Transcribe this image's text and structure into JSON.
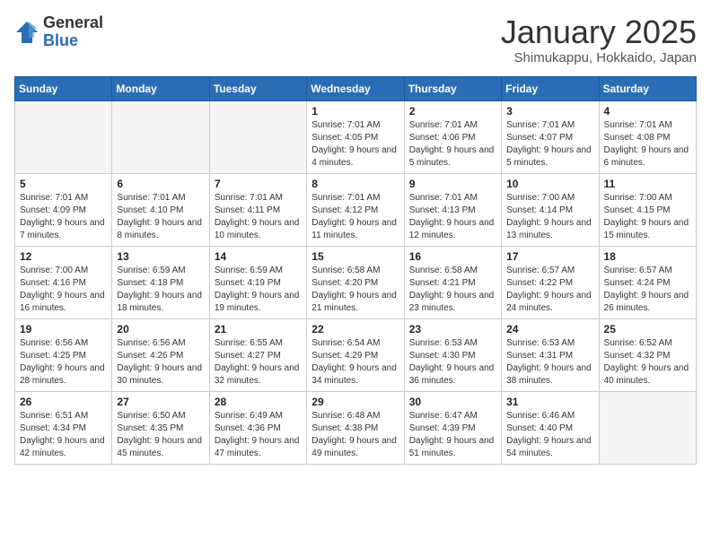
{
  "header": {
    "logo_general": "General",
    "logo_blue": "Blue",
    "month_title": "January 2025",
    "location": "Shimukappu, Hokkaido, Japan"
  },
  "weekdays": [
    "Sunday",
    "Monday",
    "Tuesday",
    "Wednesday",
    "Thursday",
    "Friday",
    "Saturday"
  ],
  "weeks": [
    [
      {
        "day": "",
        "info": ""
      },
      {
        "day": "",
        "info": ""
      },
      {
        "day": "",
        "info": ""
      },
      {
        "day": "1",
        "info": "Sunrise: 7:01 AM\nSunset: 4:05 PM\nDaylight: 9 hours and 4 minutes."
      },
      {
        "day": "2",
        "info": "Sunrise: 7:01 AM\nSunset: 4:06 PM\nDaylight: 9 hours and 5 minutes."
      },
      {
        "day": "3",
        "info": "Sunrise: 7:01 AM\nSunset: 4:07 PM\nDaylight: 9 hours and 5 minutes."
      },
      {
        "day": "4",
        "info": "Sunrise: 7:01 AM\nSunset: 4:08 PM\nDaylight: 9 hours and 6 minutes."
      }
    ],
    [
      {
        "day": "5",
        "info": "Sunrise: 7:01 AM\nSunset: 4:09 PM\nDaylight: 9 hours and 7 minutes."
      },
      {
        "day": "6",
        "info": "Sunrise: 7:01 AM\nSunset: 4:10 PM\nDaylight: 9 hours and 8 minutes."
      },
      {
        "day": "7",
        "info": "Sunrise: 7:01 AM\nSunset: 4:11 PM\nDaylight: 9 hours and 10 minutes."
      },
      {
        "day": "8",
        "info": "Sunrise: 7:01 AM\nSunset: 4:12 PM\nDaylight: 9 hours and 11 minutes."
      },
      {
        "day": "9",
        "info": "Sunrise: 7:01 AM\nSunset: 4:13 PM\nDaylight: 9 hours and 12 minutes."
      },
      {
        "day": "10",
        "info": "Sunrise: 7:00 AM\nSunset: 4:14 PM\nDaylight: 9 hours and 13 minutes."
      },
      {
        "day": "11",
        "info": "Sunrise: 7:00 AM\nSunset: 4:15 PM\nDaylight: 9 hours and 15 minutes."
      }
    ],
    [
      {
        "day": "12",
        "info": "Sunrise: 7:00 AM\nSunset: 4:16 PM\nDaylight: 9 hours and 16 minutes."
      },
      {
        "day": "13",
        "info": "Sunrise: 6:59 AM\nSunset: 4:18 PM\nDaylight: 9 hours and 18 minutes."
      },
      {
        "day": "14",
        "info": "Sunrise: 6:59 AM\nSunset: 4:19 PM\nDaylight: 9 hours and 19 minutes."
      },
      {
        "day": "15",
        "info": "Sunrise: 6:58 AM\nSunset: 4:20 PM\nDaylight: 9 hours and 21 minutes."
      },
      {
        "day": "16",
        "info": "Sunrise: 6:58 AM\nSunset: 4:21 PM\nDaylight: 9 hours and 23 minutes."
      },
      {
        "day": "17",
        "info": "Sunrise: 6:57 AM\nSunset: 4:22 PM\nDaylight: 9 hours and 24 minutes."
      },
      {
        "day": "18",
        "info": "Sunrise: 6:57 AM\nSunset: 4:24 PM\nDaylight: 9 hours and 26 minutes."
      }
    ],
    [
      {
        "day": "19",
        "info": "Sunrise: 6:56 AM\nSunset: 4:25 PM\nDaylight: 9 hours and 28 minutes."
      },
      {
        "day": "20",
        "info": "Sunrise: 6:56 AM\nSunset: 4:26 PM\nDaylight: 9 hours and 30 minutes."
      },
      {
        "day": "21",
        "info": "Sunrise: 6:55 AM\nSunset: 4:27 PM\nDaylight: 9 hours and 32 minutes."
      },
      {
        "day": "22",
        "info": "Sunrise: 6:54 AM\nSunset: 4:29 PM\nDaylight: 9 hours and 34 minutes."
      },
      {
        "day": "23",
        "info": "Sunrise: 6:53 AM\nSunset: 4:30 PM\nDaylight: 9 hours and 36 minutes."
      },
      {
        "day": "24",
        "info": "Sunrise: 6:53 AM\nSunset: 4:31 PM\nDaylight: 9 hours and 38 minutes."
      },
      {
        "day": "25",
        "info": "Sunrise: 6:52 AM\nSunset: 4:32 PM\nDaylight: 9 hours and 40 minutes."
      }
    ],
    [
      {
        "day": "26",
        "info": "Sunrise: 6:51 AM\nSunset: 4:34 PM\nDaylight: 9 hours and 42 minutes."
      },
      {
        "day": "27",
        "info": "Sunrise: 6:50 AM\nSunset: 4:35 PM\nDaylight: 9 hours and 45 minutes."
      },
      {
        "day": "28",
        "info": "Sunrise: 6:49 AM\nSunset: 4:36 PM\nDaylight: 9 hours and 47 minutes."
      },
      {
        "day": "29",
        "info": "Sunrise: 6:48 AM\nSunset: 4:38 PM\nDaylight: 9 hours and 49 minutes."
      },
      {
        "day": "30",
        "info": "Sunrise: 6:47 AM\nSunset: 4:39 PM\nDaylight: 9 hours and 51 minutes."
      },
      {
        "day": "31",
        "info": "Sunrise: 6:46 AM\nSunset: 4:40 PM\nDaylight: 9 hours and 54 minutes."
      },
      {
        "day": "",
        "info": ""
      }
    ]
  ]
}
